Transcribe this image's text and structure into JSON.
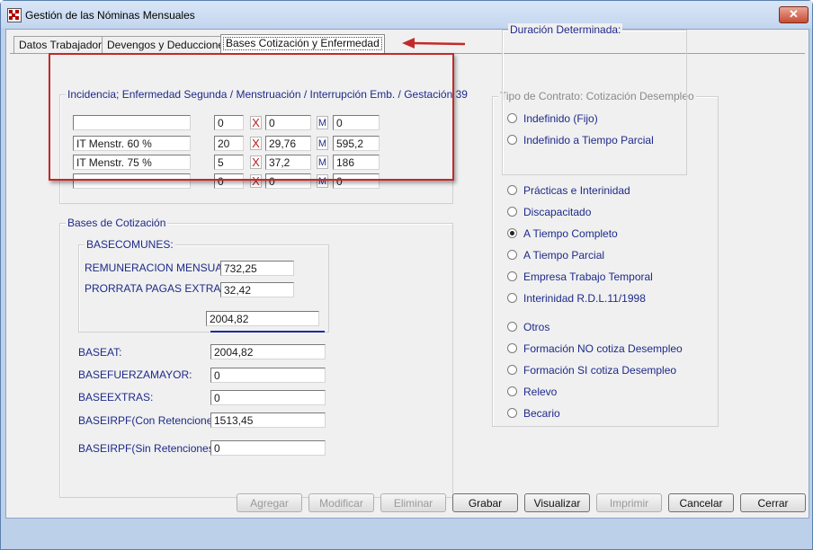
{
  "window": {
    "title": "Gestión de las Nóminas Mensuales",
    "close_symbol": "✕"
  },
  "tabs": [
    {
      "label": "Datos Trabajador"
    },
    {
      "label": "Devengos y Deducciones"
    },
    {
      "label": "Bases Cotización y Enfermedad"
    }
  ],
  "incidencia": {
    "legend": "Incidencia; Enfermedad Segunda / Menstruación / Interrupción Emb. /  Gestación 39",
    "rows": [
      {
        "desc": "",
        "a": "0",
        "b": "0",
        "c": "0"
      },
      {
        "desc": "IT Menstr. 60 %",
        "a": "20",
        "b": "29,76",
        "c": "595,2"
      },
      {
        "desc": "IT Menstr. 75 %",
        "a": "5",
        "b": "37,2",
        "c": "186"
      },
      {
        "desc": "",
        "a": "0",
        "b": "0",
        "c": "0"
      }
    ],
    "x_symbol": "X",
    "m_symbol": "M"
  },
  "bases": {
    "legend": "Bases de Cotización",
    "comunes_legend": "BASECOMUNES:",
    "remuneracion_label": "REMUNERACION MENSUAL:",
    "remuneracion_value": "732,25",
    "prorrata_label": "PRORRATA PAGAS EXTRAS:",
    "prorrata_value": "32,42",
    "total_value": "2004,82",
    "fields": [
      {
        "label": "BASEAT:",
        "value": "2004,82"
      },
      {
        "label": "BASEFUERZAMAYOR:",
        "value": "0"
      },
      {
        "label": "BASEEXTRAS:",
        "value": "0"
      },
      {
        "label": "BASEIRPF(Con Retenciones):",
        "value": "1513,45"
      },
      {
        "label": "BASEIRPF(Sin Retenciones):",
        "value": "0"
      }
    ]
  },
  "contrato": {
    "legend": "Tipo de Contrato: Cotización Desempleo",
    "options_top": [
      "Indefinido (Fijo)",
      "Indefinido a Tiempo Parcial"
    ],
    "duracion_legend": "Duración Determinada:",
    "options_duracion": [
      "Prácticas e Interinidad",
      "Discapacitado",
      "A Tiempo Completo",
      "A Tiempo Parcial",
      "Empresa Trabajo Temporal",
      "Interinidad R.D.L.11/1998"
    ],
    "options_bottom": [
      "Otros",
      "Formación NO cotiza Desempleo",
      "Formación SI cotiza Desempleo",
      "Relevo",
      "Becario"
    ],
    "selected": "A Tiempo Completo"
  },
  "buttons": {
    "agregar": {
      "label": "Agregar",
      "enabled": false
    },
    "modificar": {
      "label": "Modificar",
      "enabled": false
    },
    "eliminar": {
      "label": "Eliminar",
      "enabled": false
    },
    "grabar": {
      "label": "Grabar",
      "enabled": true
    },
    "visualizar": {
      "label": "Visualizar",
      "enabled": true
    },
    "imprimir": {
      "label": "Imprimir",
      "enabled": false
    },
    "cancelar": {
      "label": "Cancelar",
      "enabled": true
    },
    "cerrar": {
      "label": "Cerrar",
      "enabled": true
    }
  },
  "colors": {
    "label_blue": "#1e2a8a",
    "highlight_red": "#c22a2a",
    "window_frame": "#bcd0ea"
  }
}
